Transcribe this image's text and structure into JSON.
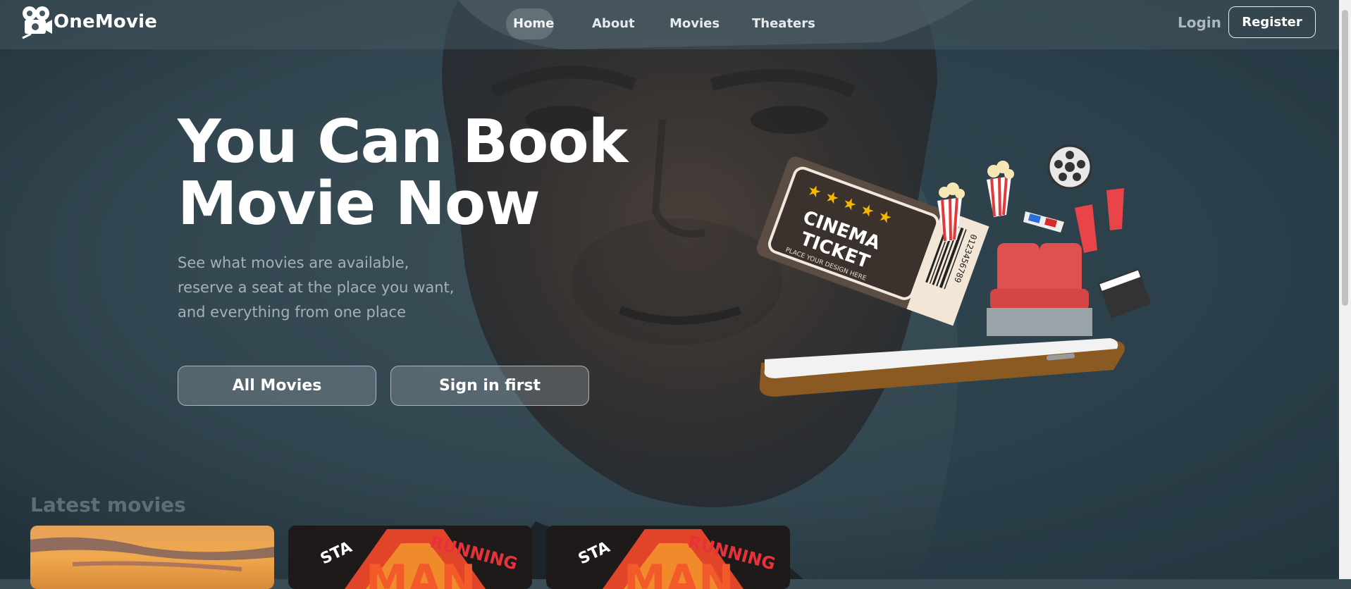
{
  "brand": {
    "name": "OneMovie",
    "logo_icon": "film-camera-icon"
  },
  "nav": {
    "links": [
      {
        "label": "Home",
        "active": true
      },
      {
        "label": "About",
        "active": false
      },
      {
        "label": "Movies",
        "active": false
      },
      {
        "label": "Theaters",
        "active": false
      }
    ],
    "login_label": "Login",
    "register_label": "Register"
  },
  "hero": {
    "title_line1": "You Can Book",
    "title_line2": "Movie Now",
    "subtitle_line1": "See what movies are available,",
    "subtitle_line2": "reserve a seat at the place you want,",
    "subtitle_line3": "and everything from one place",
    "primary_button": "All Movies",
    "secondary_button": "Sign in first",
    "illustration": {
      "ticket_line1": "CINEMA",
      "ticket_line2": "TICKET",
      "ticket_small": "PLACE YOUR DESIGN HERE",
      "ticket_number": "0123456789"
    }
  },
  "latest": {
    "title": "Latest movies",
    "cards": [
      {
        "icon": "sunset-poster"
      },
      {
        "icon": "running-man-poster",
        "poster_text": "STA",
        "poster_text2": "RUNNING",
        "poster_big": "MAN"
      },
      {
        "icon": "running-man-poster",
        "poster_text": "STA",
        "poster_text2": "RUNNING",
        "poster_big": "MAN"
      }
    ]
  },
  "colors": {
    "accent": "#ffffff",
    "background": "#3a4d57",
    "muted": "#a6b1b6"
  }
}
